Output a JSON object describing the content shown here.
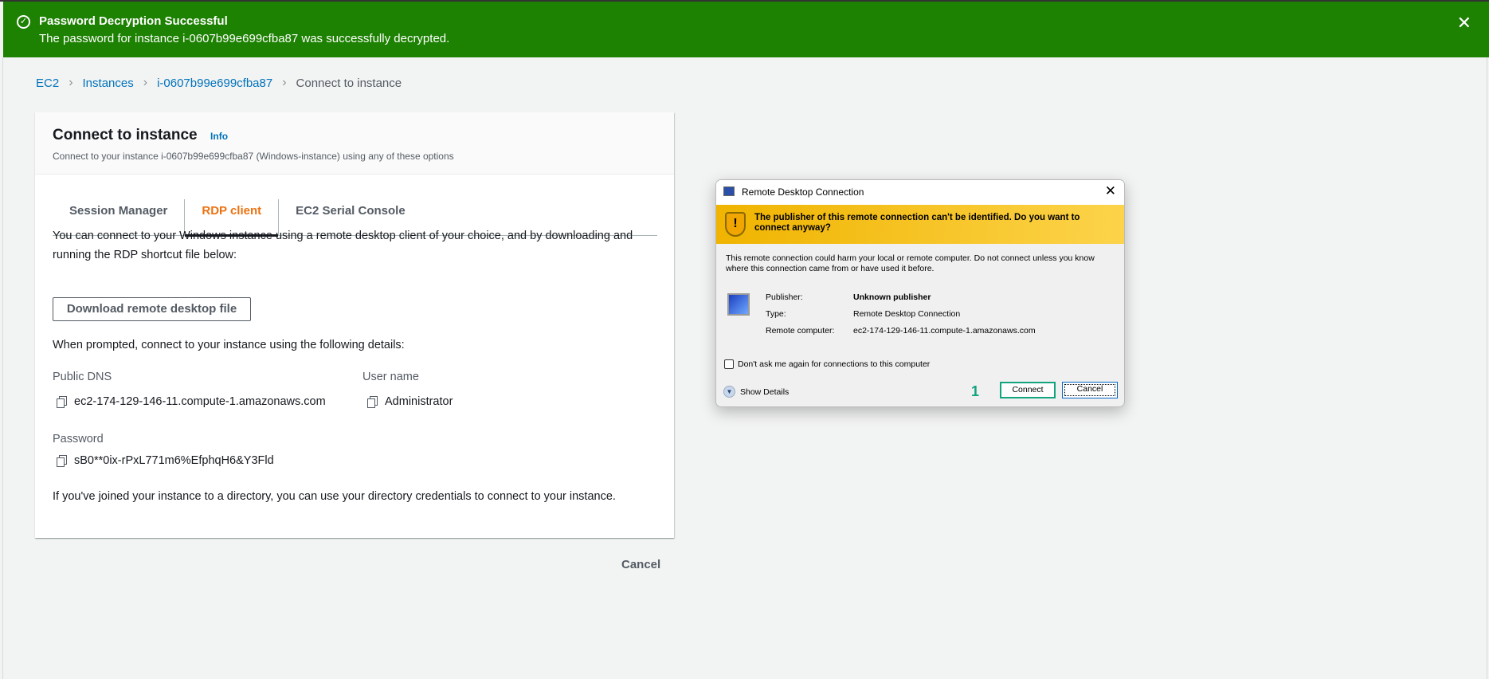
{
  "notification": {
    "title": "Password Decryption Successful",
    "message": "The password for instance i-0607b99e699cfba87 was successfully decrypted.",
    "close": "✕",
    "icon": "✓",
    "color": "#1d8102"
  },
  "breadcrumb": {
    "items": [
      "EC2",
      "Instances",
      "i-0607b99e699cfba87"
    ],
    "current": "Connect to instance",
    "sep": "›"
  },
  "card": {
    "title": "Connect to instance",
    "info": "Info",
    "subtitle": "Connect to your instance i-0607b99e699cfba87 (Windows-instance) using any of these options",
    "tabs": [
      "Session Manager",
      "RDP client",
      "EC2 Serial Console"
    ],
    "active_tab": "RDP client",
    "intro": "You can connect to your Windows instance using a remote desktop client of your choice, and by downloading and running the RDP shortcut file below:",
    "download_button": "Download remote desktop file",
    "prompt": "When prompted, connect to your instance using the following details:",
    "public_dns_label": "Public DNS",
    "public_dns": "ec2-174-129-146-11.compute-1.amazonaws.com",
    "username_label": "User name",
    "username": "Administrator",
    "password_label": "Password",
    "password": "sB0**0ix-rPxL771m6%EfphqH6&Y3Fld",
    "directory_note": "If you've joined your instance to a directory, you can use your directory credentials to connect to your instance."
  },
  "cancel": "Cancel",
  "dialog": {
    "title": "Remote Desktop Connection",
    "close": "✕",
    "warning": "The publisher of this remote connection can't be identified. Do you want to connect anyway?",
    "message": "This remote connection could harm your local or remote computer. Do not connect unless you know where this connection came from or have used it before.",
    "publisher_label": "Publisher:",
    "publisher": "Unknown publisher",
    "type_label": "Type:",
    "type": "Remote Desktop Connection",
    "remote_label": "Remote computer:",
    "remote": "ec2-174-129-146-11.compute-1.amazonaws.com",
    "checkbox": "Don't ask me again for connections to this computer",
    "show_details": "Show Details",
    "step": "1",
    "connect": "Connect",
    "cancel": "Cancel"
  }
}
